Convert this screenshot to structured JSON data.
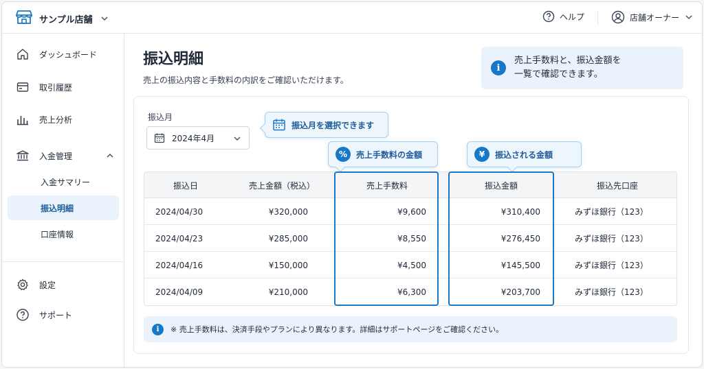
{
  "header": {
    "store_name": "サンプル店舗",
    "help_label": "ヘルプ",
    "owner_label": "店舗オーナー"
  },
  "sidebar": {
    "items": [
      {
        "label": "ダッシュボード",
        "icon": "home-icon"
      },
      {
        "label": "取引履歴",
        "icon": "card-icon"
      },
      {
        "label": "売上分析",
        "icon": "bar-chart-icon"
      },
      {
        "label": "入金管理",
        "icon": "bank-icon",
        "expanded": true
      },
      {
        "label": "設定",
        "icon": "gear-icon"
      },
      {
        "label": "サポート",
        "icon": "question-icon"
      }
    ],
    "sub_items": [
      {
        "label": "入金サマリー",
        "active": false
      },
      {
        "label": "振込明細",
        "active": true
      },
      {
        "label": "口座情報",
        "active": false
      }
    ]
  },
  "page": {
    "title": "振込明細",
    "subtitle": "売上の振込内容と手数料の内訳をご確認いただけます。",
    "info_line1": "売上手数料と、振込金額を",
    "info_line2": "一覧で確認できます。"
  },
  "filter": {
    "month_label": "振込月",
    "month_value": "2024年4月"
  },
  "callouts": {
    "month": "振込月を選択できます",
    "fee": "売上手数料の金額",
    "transfer": "振込される金額",
    "fee_symbol": "%",
    "transfer_symbol": "¥"
  },
  "table": {
    "headers": [
      "振込日",
      "売上金額（税込）",
      "売上手数料",
      "振込金額",
      "振込先口座"
    ],
    "rows": [
      {
        "date": "2024/04/30",
        "sales": "¥320,000",
        "fee": "¥9,600",
        "transfer": "¥310,400",
        "account": "みずほ銀行（123）"
      },
      {
        "date": "2024/04/23",
        "sales": "¥285,000",
        "fee": "¥8,550",
        "transfer": "¥276,450",
        "account": "みずほ銀行（123）"
      },
      {
        "date": "2024/04/16",
        "sales": "¥150,000",
        "fee": "¥4,500",
        "transfer": "¥145,500",
        "account": "みずほ銀行（123）"
      },
      {
        "date": "2024/04/09",
        "sales": "¥210,000",
        "fee": "¥6,300",
        "transfer": "¥203,700",
        "account": "みずほ銀行（123）"
      }
    ]
  },
  "note": "※ 売上手数料は、決済手段やプランにより異なります。詳細はサポートページをご確認ください。",
  "colors": {
    "accent": "#1878c8",
    "active_bg": "#eaf3fb",
    "info_bg": "#eaf3fb"
  }
}
